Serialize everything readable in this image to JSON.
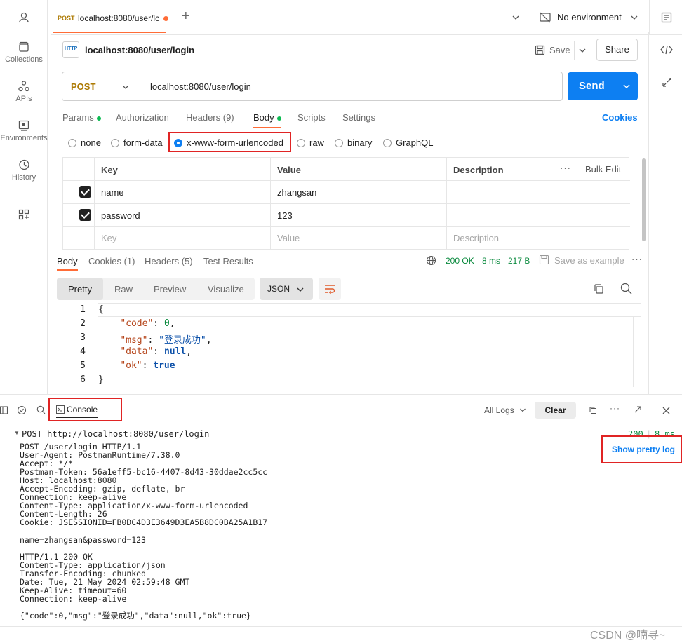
{
  "sidebar": {
    "items": [
      {
        "label": "",
        "icon": "user-icon"
      },
      {
        "label": "Collections",
        "icon": "collections-icon"
      },
      {
        "label": "APIs",
        "icon": "apis-icon"
      },
      {
        "label": "Environments",
        "icon": "environments-icon"
      },
      {
        "label": "History",
        "icon": "history-icon"
      },
      {
        "label": "",
        "icon": "add-apps-icon"
      }
    ]
  },
  "tabs": {
    "active_method": "POST",
    "active_title": "localhost:8080/user/lc",
    "environment": "No environment"
  },
  "request": {
    "title": "localhost:8080/user/login",
    "save_label": "Save",
    "share_label": "Share",
    "method": "POST",
    "url": "localhost:8080/user/login",
    "send_label": "Send",
    "tabs": [
      "Params",
      "Authorization",
      "Headers (9)",
      "Body",
      "Scripts",
      "Settings"
    ],
    "cookies_label": "Cookies",
    "body_types": [
      "none",
      "form-data",
      "x-www-form-urlencoded",
      "raw",
      "binary",
      "GraphQL"
    ],
    "selected_body_type": "x-www-form-urlencoded",
    "table": {
      "headers": [
        "Key",
        "Value",
        "Description"
      ],
      "bulk_edit": "Bulk Edit",
      "rows": [
        {
          "key": "name",
          "value": "zhangsan",
          "description": "",
          "checked": true
        },
        {
          "key": "password",
          "value": "123",
          "description": "",
          "checked": true
        }
      ],
      "placeholder": {
        "key": "Key",
        "value": "Value",
        "description": "Description"
      }
    }
  },
  "response": {
    "tabs": [
      "Body",
      "Cookies (1)",
      "Headers (5)",
      "Test Results"
    ],
    "status": "200 OK",
    "time": "8 ms",
    "size": "217 B",
    "save_example": "Save as example",
    "view_tabs": [
      "Pretty",
      "Raw",
      "Preview",
      "Visualize"
    ],
    "format": "JSON",
    "lines": [
      "1",
      "2",
      "3",
      "4",
      "5",
      "6"
    ]
  },
  "console": {
    "tab_label": "Console",
    "all_logs": "All Logs",
    "clear_label": "Clear",
    "request_line": "POST http://localhost:8080/user/login",
    "status_code": "200",
    "status_time": "8 ms",
    "pretty_log": "Show pretty log",
    "request_block": "POST /user/login HTTP/1.1\nUser-Agent: PostmanRuntime/7.38.0\nAccept: */*\nPostman-Token: 56a1eff5-bc16-4407-8d43-30ddae2cc5cc\nHost: localhost:8080\nAccept-Encoding: gzip, deflate, br\nConnection: keep-alive\nContent-Type: application/x-www-form-urlencoded\nContent-Length: 26\nCookie: JSESSIONID=FB0DC4D3E3649D3EA5B8DC0BA25A1B17",
    "body_line": "name=zhangsan&password=123",
    "response_block": "HTTP/1.1 200 OK\nContent-Type: application/json\nTransfer-Encoding: chunked\nDate: Tue, 21 May 2024 02:59:48 GMT\nKeep-Alive: timeout=60\nConnection: keep-alive",
    "response_body": "{\"code\":0,\"msg\":\"登录成功\",\"data\":null,\"ok\":true}"
  },
  "watermark": "CSDN @喃寻~",
  "colors": {
    "accent": "#0d7ff2",
    "orange": "#ff6c37",
    "green": "#0cbb52",
    "highlight": "#e02424"
  }
}
